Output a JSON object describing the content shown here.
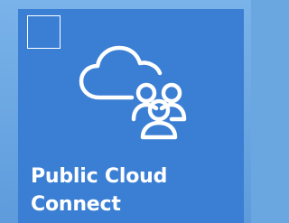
{
  "tile": {
    "label_line1": "Public Cloud",
    "label_line2": "Connect",
    "background_color": "#3b7fd4",
    "icon": "cloud-users-icon",
    "checkbox_icon": "checkbox-icon"
  }
}
